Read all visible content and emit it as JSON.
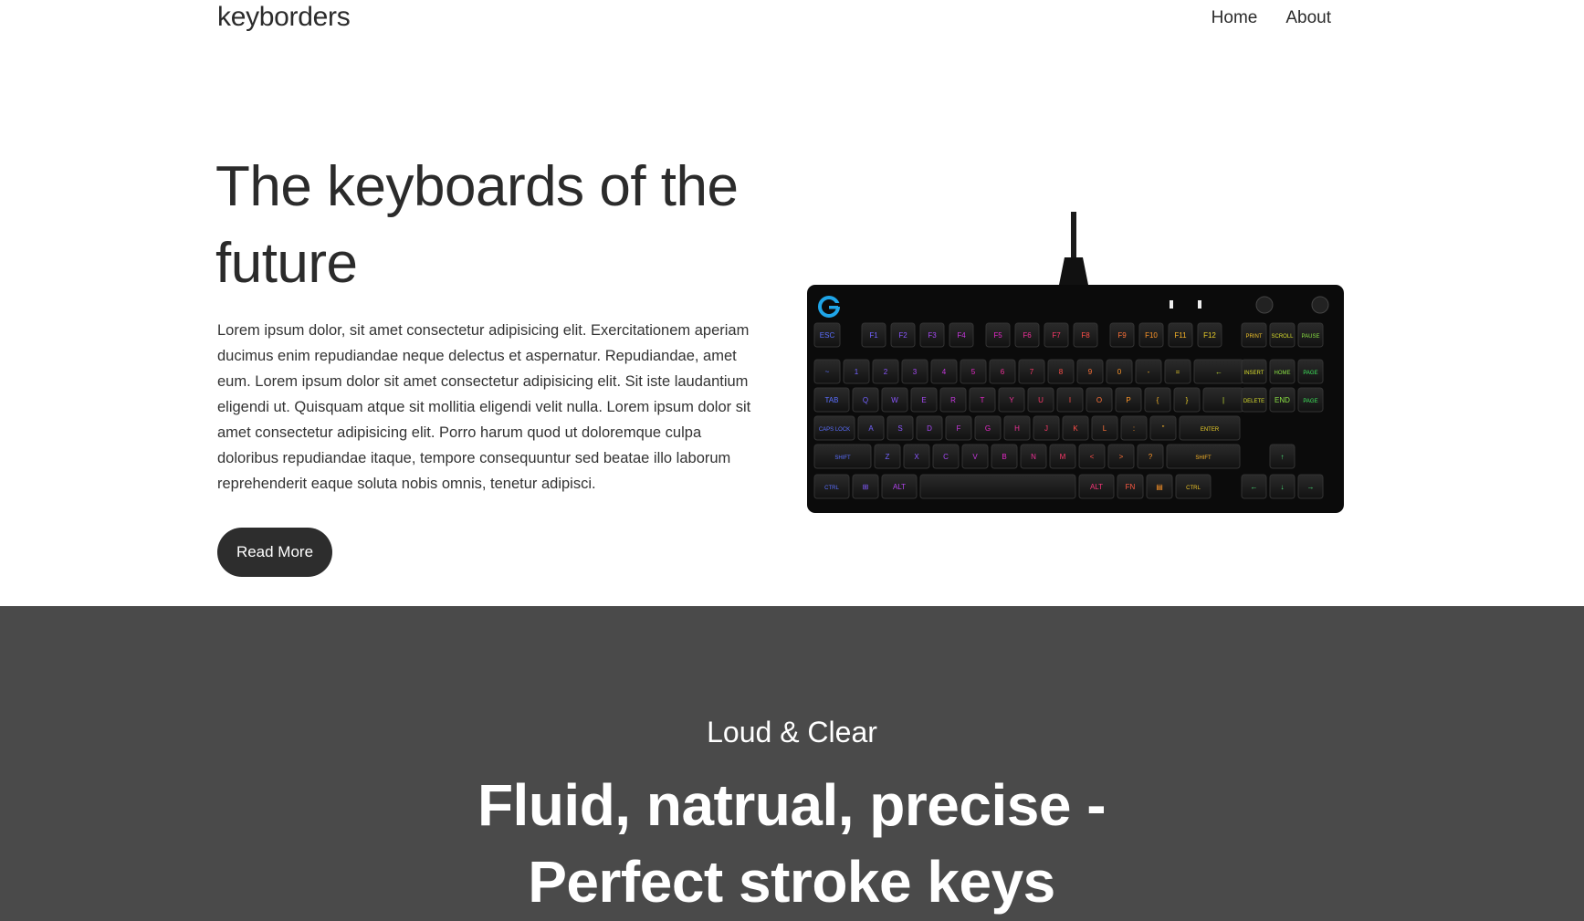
{
  "nav": {
    "brand": "keyborders",
    "links": [
      "Home",
      "About"
    ]
  },
  "hero": {
    "title": "The keyboards of the future",
    "body": "Lorem ipsum dolor, sit amet consectetur adipisicing elit. Exercitationem aperiam ducimus enim repudiandae neque delectus et aspernatur. Repudiandae, amet eum. Lorem ipsum dolor sit amet consectetur adipisicing elit. Sit iste laudantium eligendi ut. Quisquam atque sit mollitia eligendi velit nulla. Lorem ipsum dolor sit amet consectetur adipisicing elit. Porro harum quod ut doloremque culpa doloribus repudiandae itaque, tempore consequuntur sed beatae illo laborum reprehenderit eaque soluta nobis omnis, tenetur adipisci.",
    "button": "Read More"
  },
  "keyboard": {
    "row_fn": [
      "ESC",
      "F1",
      "F2",
      "F3",
      "F4",
      "F5",
      "F6",
      "F7",
      "F8",
      "F9",
      "F10",
      "F11",
      "F12"
    ],
    "row_num": [
      "~",
      "1",
      "2",
      "3",
      "4",
      "5",
      "6",
      "7",
      "8",
      "9",
      "0",
      "-",
      "=",
      "←"
    ],
    "row_q": [
      "TAB",
      "Q",
      "W",
      "E",
      "R",
      "T",
      "Y",
      "U",
      "I",
      "O",
      "P",
      "{",
      "}",
      "|"
    ],
    "row_a": [
      "CAPS LOCK",
      "A",
      "S",
      "D",
      "F",
      "G",
      "H",
      "J",
      "K",
      "L",
      ":",
      "\"",
      "ENTER"
    ],
    "row_z": [
      "SHIFT",
      "Z",
      "X",
      "C",
      "V",
      "B",
      "N",
      "M",
      "<",
      ">",
      "?",
      "SHIFT"
    ],
    "row_bottom": [
      "CTRL",
      "⊞",
      "ALT",
      "",
      "ALT",
      "FN",
      "▤",
      "CTRL"
    ],
    "nav_cluster": [
      "PRINT SCRN",
      "SCROLL LOCK",
      "PAUSE BREAK",
      "INSERT",
      "HOME",
      "PAGE UP",
      "DELETE",
      "END",
      "PAGE DOWN"
    ],
    "arrows": [
      "↑",
      "←",
      "↓",
      "→"
    ]
  },
  "section2": {
    "subtitle": "Loud & Clear",
    "title": "Fluid, natrual, precise - Perfect stroke keys"
  }
}
